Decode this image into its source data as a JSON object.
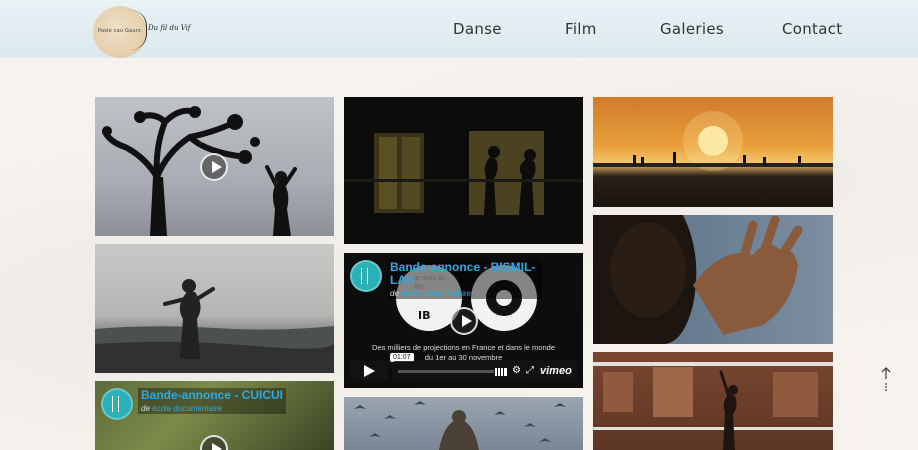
{
  "header": {
    "logo_caption": "Pasle cau Gaurz",
    "brand": "Du fil du Vif",
    "nav": [
      {
        "label": "Danse"
      },
      {
        "label": "Film"
      },
      {
        "label": "Galeries"
      },
      {
        "label": "Contact"
      }
    ]
  },
  "videos": {
    "bismillah": {
      "title": "Bande-annonce - BISMIL-LAH",
      "by_prefix": "de",
      "by_channel": "école documentaire",
      "caption_line1": "Des milliers de projections en France et dans le monde",
      "caption_line2": "du 1er au 30 novembre",
      "timecode": "01:07",
      "vimeo_logo": "vimeo",
      "overlay_text": "le mois du film"
    },
    "cuicui": {
      "title": "Bande-annonce - CUICUI",
      "by_prefix": "de",
      "by_channel": "école documentaire"
    }
  },
  "colors": {
    "accent": "#2fa9e0",
    "header_bg": "#dbe9ee"
  }
}
